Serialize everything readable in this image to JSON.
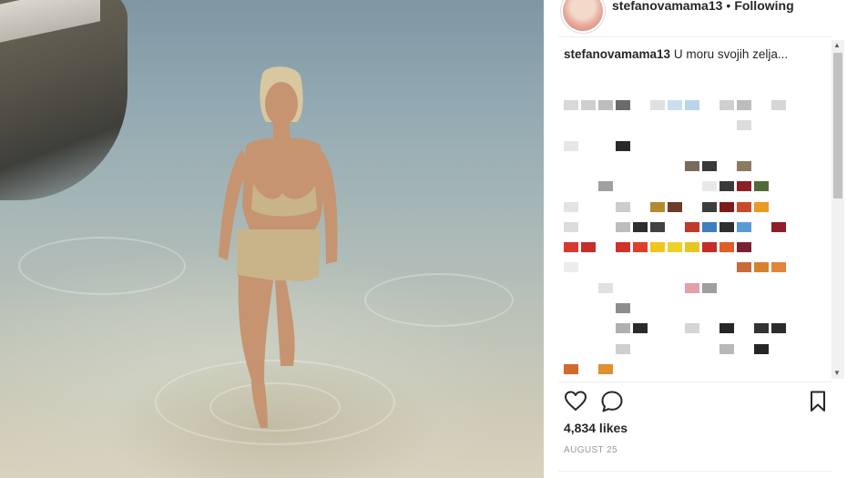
{
  "post": {
    "username": "stefanovamama13",
    "separator": "•",
    "follow_status": "Following",
    "caption_text": "U moru svojih zelja...",
    "likes": "4,834 likes",
    "date": "AUGUST 25"
  },
  "icons": {
    "like": "heart-icon",
    "comment": "comment-bubble-icon",
    "save": "bookmark-icon",
    "scroll_up": "▲",
    "scroll_down": "▼"
  },
  "colors": {
    "text": "#262626",
    "muted": "#999999",
    "divider": "#efefef"
  },
  "pixelated_comments": [
    [
      "#d9d9d9",
      "#cfcfcf",
      "#bdbdbd",
      "#6b6b6b",
      "#ffffff",
      "#e0e0e0",
      "#c9dff0",
      "#b8d5ea",
      "#ffffff",
      "#d0d0d0",
      "#bdbdbd",
      "#ffffff",
      "#d6d6d6"
    ],
    [
      "#ffffff",
      "#ffffff",
      "#ffffff",
      "#ffffff",
      "#ffffff",
      "#ffffff",
      "#ffffff",
      "#ffffff",
      "#ffffff",
      "#ffffff",
      "#dcdcdc",
      "#ffffff",
      "#ffffff"
    ],
    [
      "#e6e6e6",
      "#ffffff",
      "#ffffff",
      "#2a2a2a",
      "#ffffff",
      "#ffffff",
      "#ffffff",
      "#ffffff",
      "#ffffff",
      "#ffffff",
      "#ffffff",
      "#ffffff",
      "#ffffff"
    ],
    [
      "#ffffff",
      "#ffffff",
      "#ffffff",
      "#ffffff",
      "#ffffff",
      "#ffffff",
      "#ffffff",
      "#7a6a5e",
      "#383838",
      "#ffffff",
      "#8c7b60",
      "#ffffff",
      "#ffffff"
    ],
    [
      "#ffffff",
      "#ffffff",
      "#a0a0a0",
      "#ffffff",
      "#ffffff",
      "#ffffff",
      "#ffffff",
      "#ffffff",
      "#e8e8e8",
      "#3a3a3a",
      "#8e1f24",
      "#4f6b3a",
      "#ffffff"
    ],
    [
      "#e4e4e4",
      "#ffffff",
      "#ffffff",
      "#cccccc",
      "#ffffff",
      "#b38a2e",
      "#6b3d28",
      "#ffffff",
      "#3d3d3d",
      "#7d1c1c",
      "#c84c2c",
      "#e89a24",
      "#ffffff"
    ],
    [
      "#dcdcdc",
      "#ffffff",
      "#ffffff",
      "#bdbdbd",
      "#2e2e2e",
      "#424242",
      "#ffffff",
      "#c0392b",
      "#3d7fbf",
      "#2f2f2f",
      "#5b9bd5",
      "#ffffff",
      "#8e1f2a"
    ],
    [
      "#d63a2f",
      "#c43028",
      "#ffffff",
      "#d2322c",
      "#e23d2b",
      "#f2c51c",
      "#f0d029",
      "#e6c620",
      "#c62c28",
      "#e05d2a",
      "#7a2032",
      "#ffffff",
      "#ffffff"
    ],
    [
      "#ececec",
      "#ffffff",
      "#ffffff",
      "#ffffff",
      "#ffffff",
      "#ffffff",
      "#ffffff",
      "#ffffff",
      "#ffffff",
      "#ffffff",
      "#c86a3a",
      "#d5822f",
      "#e2843a"
    ],
    [
      "#ffffff",
      "#ffffff",
      "#e0e0e0",
      "#ffffff",
      "#ffffff",
      "#ffffff",
      "#ffffff",
      "#e2a0a8",
      "#9e9e9e",
      "#ffffff",
      "#ffffff",
      "#ffffff",
      "#ffffff"
    ],
    [
      "#ffffff",
      "#ffffff",
      "#ffffff",
      "#8e8e8e",
      "#ffffff",
      "#ffffff",
      "#ffffff",
      "#ffffff",
      "#ffffff",
      "#ffffff",
      "#ffffff",
      "#ffffff",
      "#ffffff"
    ],
    [
      "#ffffff",
      "#ffffff",
      "#ffffff",
      "#b0b0b0",
      "#2a2a2a",
      "#ffffff",
      "#ffffff",
      "#d5d5d5",
      "#ffffff",
      "#262626",
      "#ffffff",
      "#333333",
      "#2c2c2c"
    ],
    [
      "#ffffff",
      "#ffffff",
      "#ffffff",
      "#cfcfcf",
      "#ffffff",
      "#ffffff",
      "#ffffff",
      "#ffffff",
      "#ffffff",
      "#b8b8b8",
      "#ffffff",
      "#262626",
      "#ffffff"
    ],
    [
      "#d26a2c",
      "#ffffff",
      "#e0902e",
      "#ffffff",
      "#ffffff",
      "#ffffff",
      "#ffffff",
      "#ffffff",
      "#ffffff",
      "#ffffff",
      "#ffffff",
      "#ffffff",
      "#ffffff"
    ],
    [
      "#ffffff",
      "#c6c6c6",
      "#bcbcbc",
      "#d0d0d0",
      "#ffffff",
      "#9a9a9a",
      "#ffffff",
      "#4a4a4a",
      "#ffffff",
      "#e0a020",
      "#ffffff",
      "#ffffff",
      "#ffffff"
    ]
  ]
}
